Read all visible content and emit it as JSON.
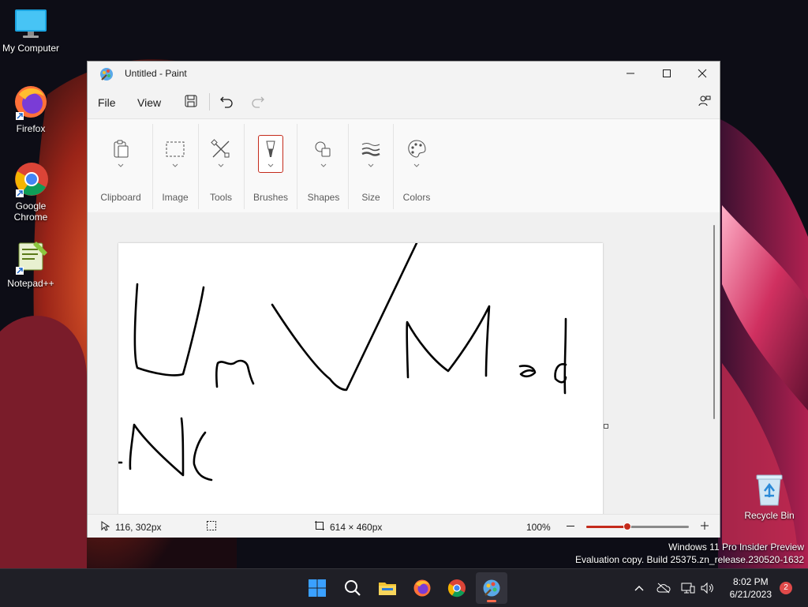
{
  "desktop": {
    "icons": [
      {
        "label": "My Computer"
      },
      {
        "label": "Firefox"
      },
      {
        "label": "Google Chrome"
      },
      {
        "label": "Notepad++"
      },
      {
        "label": "Recycle Bin"
      }
    ],
    "watermark": {
      "line1": "Windows 11 Pro Insider Preview",
      "line2": "Evaluation copy. Build 25375.zn_release.230520-1632"
    }
  },
  "paint": {
    "title": "Untitled - Paint",
    "menu": {
      "file": "File",
      "view": "View"
    },
    "ribbon": {
      "groups": [
        {
          "label": "Clipboard",
          "icon": "clipboard-icon"
        },
        {
          "label": "Image",
          "icon": "selection-icon"
        },
        {
          "label": "Tools",
          "icon": "tools-icon"
        },
        {
          "label": "Brushes",
          "icon": "brush-icon",
          "selected": true
        },
        {
          "label": "Shapes",
          "icon": "shapes-icon"
        },
        {
          "label": "Size",
          "icon": "stroke-size-icon"
        },
        {
          "label": "Colors",
          "icon": "palette-icon"
        }
      ]
    },
    "status": {
      "cursor_pos": "116, 302px",
      "canvas_size": "614 × 460px",
      "zoom": "100%",
      "zoom_level": 0.4
    },
    "colors": {
      "accent": "#c42b1c",
      "canvas": "#ffffff",
      "ink": "#000000"
    }
  },
  "taskbar": {
    "apps": [
      "start-icon",
      "search-icon",
      "file-explorer-icon",
      "firefox-icon",
      "chrome-icon",
      "paint-icon"
    ],
    "clock": {
      "time": "8:02 PM",
      "date": "6/21/2023"
    },
    "notifications": "2"
  }
}
